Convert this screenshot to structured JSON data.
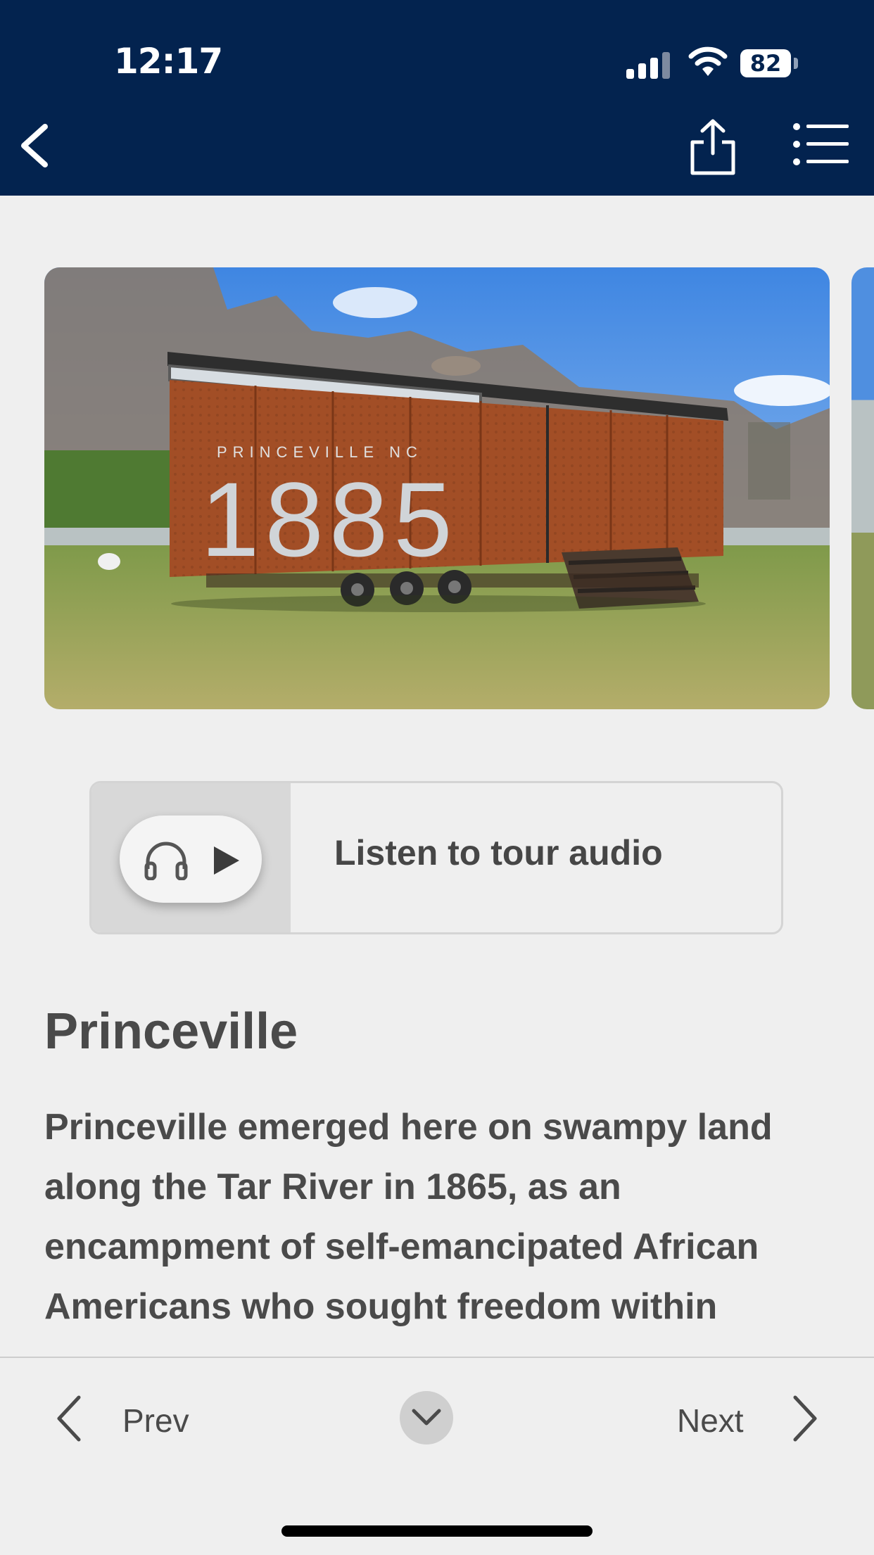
{
  "status_bar": {
    "time": "12:17",
    "battery": "82"
  },
  "toolbar": {
    "back_icon": "chevron-left-icon",
    "share_icon": "share-icon",
    "menu_icon": "list-icon"
  },
  "photo": {
    "sign_text": "PRINCEVILLE NC",
    "sign_number": "1885"
  },
  "audio": {
    "label": "Listen to tour audio",
    "icons": [
      "headphones-icon",
      "play-icon"
    ]
  },
  "content": {
    "title": "Princeville",
    "body": "Princeville emerged here on swampy land along the Tar River in 1865, as an encampment of self-emancipated African Americans who sought freedom within"
  },
  "bottom_nav": {
    "prev_label": "Prev",
    "next_label": "Next"
  },
  "colors": {
    "header": "#03234f",
    "background": "#efefef",
    "text": "#4a4a4a"
  }
}
